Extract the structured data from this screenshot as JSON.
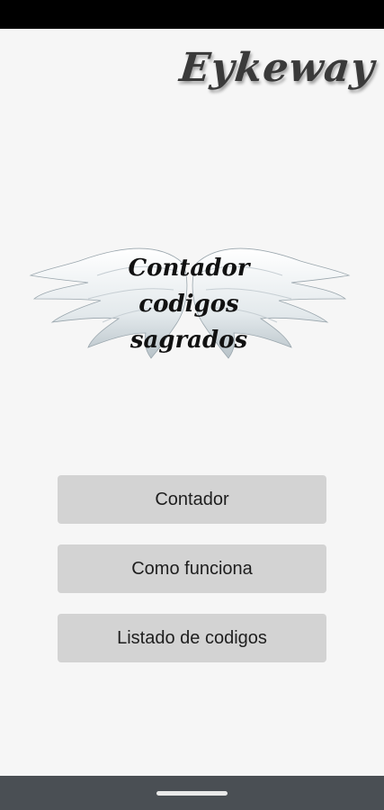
{
  "app": {
    "logo_text": "Eykeway",
    "emblem": {
      "line1": "Contador",
      "line2": "codigos",
      "line3": "sagrados"
    }
  },
  "menu": {
    "buttons": [
      {
        "label": "Contador"
      },
      {
        "label": "Como funciona"
      },
      {
        "label": "Listado de codigos"
      }
    ]
  },
  "colors": {
    "background": "#f6f6f6",
    "button": "#d3d3d3",
    "status_bar": "#000000",
    "nav_bar": "#4a4f54"
  }
}
